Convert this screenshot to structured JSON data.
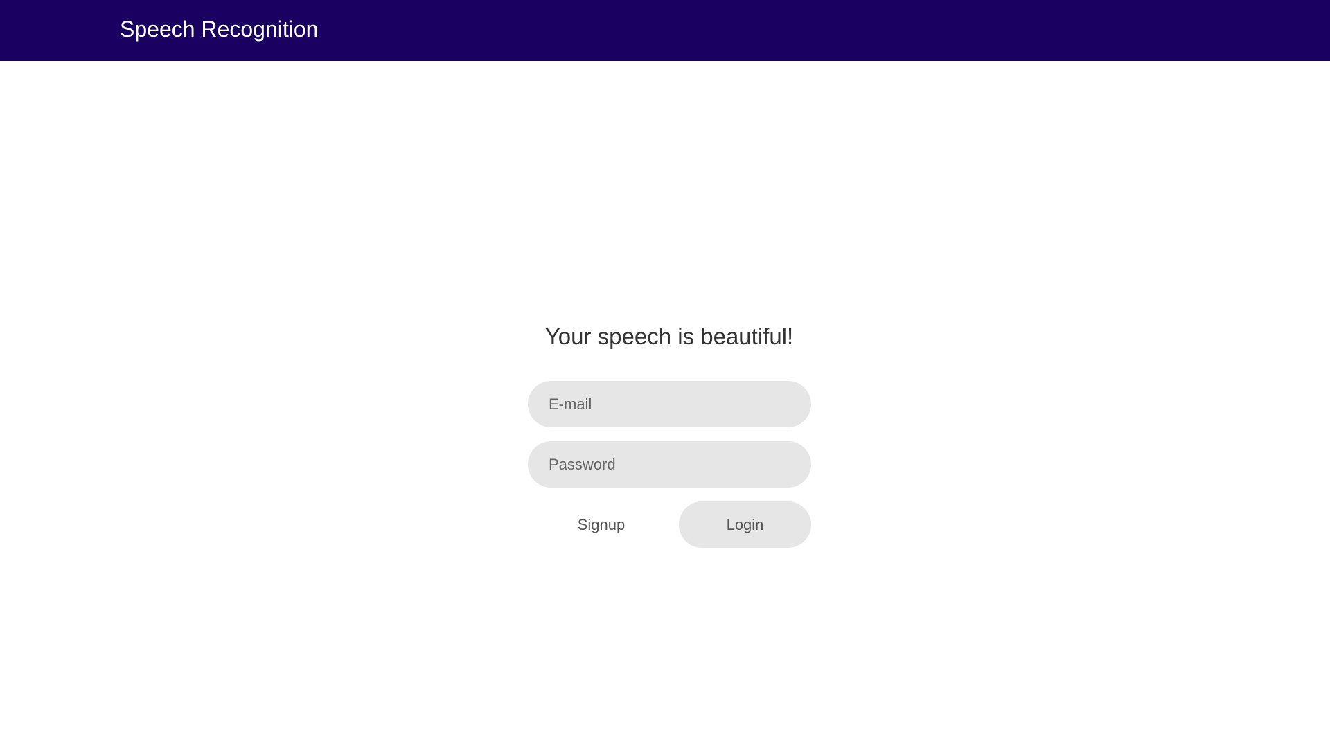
{
  "header": {
    "app_title": "Speech Recognition",
    "logo_icon": "sound-wave-icon",
    "background_color": "#1a0060",
    "accent_color": "#e020c8"
  },
  "login": {
    "headline": "Your speech is beautiful!",
    "email_placeholder": "E-mail",
    "email_value": "",
    "password_placeholder": "Password",
    "password_value": "",
    "signup_label": "Signup",
    "login_label": "Login"
  }
}
